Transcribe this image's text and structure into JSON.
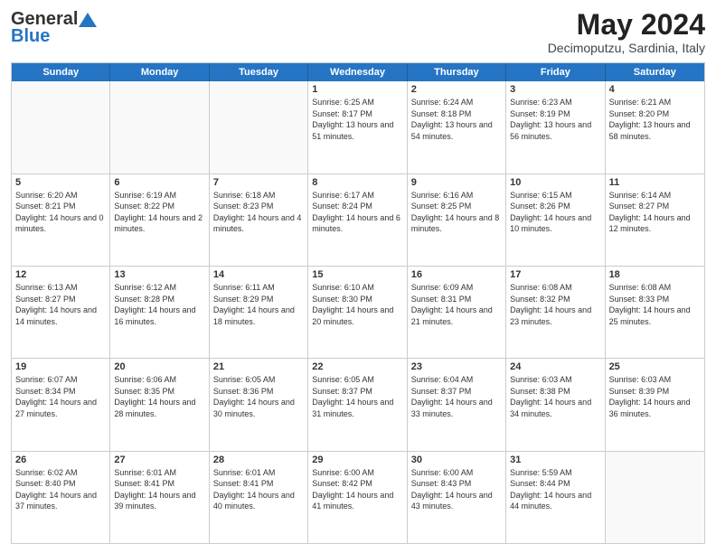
{
  "header": {
    "logo_general": "General",
    "logo_blue": "Blue",
    "month_title": "May 2024",
    "location": "Decimoputzu, Sardinia, Italy"
  },
  "calendar": {
    "days": [
      "Sunday",
      "Monday",
      "Tuesday",
      "Wednesday",
      "Thursday",
      "Friday",
      "Saturday"
    ],
    "rows": [
      [
        {
          "day": "",
          "empty": true
        },
        {
          "day": "",
          "empty": true
        },
        {
          "day": "",
          "empty": true
        },
        {
          "day": "1",
          "sunrise": "Sunrise: 6:25 AM",
          "sunset": "Sunset: 8:17 PM",
          "daylight": "Daylight: 13 hours and 51 minutes."
        },
        {
          "day": "2",
          "sunrise": "Sunrise: 6:24 AM",
          "sunset": "Sunset: 8:18 PM",
          "daylight": "Daylight: 13 hours and 54 minutes."
        },
        {
          "day": "3",
          "sunrise": "Sunrise: 6:23 AM",
          "sunset": "Sunset: 8:19 PM",
          "daylight": "Daylight: 13 hours and 56 minutes."
        },
        {
          "day": "4",
          "sunrise": "Sunrise: 6:21 AM",
          "sunset": "Sunset: 8:20 PM",
          "daylight": "Daylight: 13 hours and 58 minutes."
        }
      ],
      [
        {
          "day": "5",
          "sunrise": "Sunrise: 6:20 AM",
          "sunset": "Sunset: 8:21 PM",
          "daylight": "Daylight: 14 hours and 0 minutes."
        },
        {
          "day": "6",
          "sunrise": "Sunrise: 6:19 AM",
          "sunset": "Sunset: 8:22 PM",
          "daylight": "Daylight: 14 hours and 2 minutes."
        },
        {
          "day": "7",
          "sunrise": "Sunrise: 6:18 AM",
          "sunset": "Sunset: 8:23 PM",
          "daylight": "Daylight: 14 hours and 4 minutes."
        },
        {
          "day": "8",
          "sunrise": "Sunrise: 6:17 AM",
          "sunset": "Sunset: 8:24 PM",
          "daylight": "Daylight: 14 hours and 6 minutes."
        },
        {
          "day": "9",
          "sunrise": "Sunrise: 6:16 AM",
          "sunset": "Sunset: 8:25 PM",
          "daylight": "Daylight: 14 hours and 8 minutes."
        },
        {
          "day": "10",
          "sunrise": "Sunrise: 6:15 AM",
          "sunset": "Sunset: 8:26 PM",
          "daylight": "Daylight: 14 hours and 10 minutes."
        },
        {
          "day": "11",
          "sunrise": "Sunrise: 6:14 AM",
          "sunset": "Sunset: 8:27 PM",
          "daylight": "Daylight: 14 hours and 12 minutes."
        }
      ],
      [
        {
          "day": "12",
          "sunrise": "Sunrise: 6:13 AM",
          "sunset": "Sunset: 8:27 PM",
          "daylight": "Daylight: 14 hours and 14 minutes."
        },
        {
          "day": "13",
          "sunrise": "Sunrise: 6:12 AM",
          "sunset": "Sunset: 8:28 PM",
          "daylight": "Daylight: 14 hours and 16 minutes."
        },
        {
          "day": "14",
          "sunrise": "Sunrise: 6:11 AM",
          "sunset": "Sunset: 8:29 PM",
          "daylight": "Daylight: 14 hours and 18 minutes."
        },
        {
          "day": "15",
          "sunrise": "Sunrise: 6:10 AM",
          "sunset": "Sunset: 8:30 PM",
          "daylight": "Daylight: 14 hours and 20 minutes."
        },
        {
          "day": "16",
          "sunrise": "Sunrise: 6:09 AM",
          "sunset": "Sunset: 8:31 PM",
          "daylight": "Daylight: 14 hours and 21 minutes."
        },
        {
          "day": "17",
          "sunrise": "Sunrise: 6:08 AM",
          "sunset": "Sunset: 8:32 PM",
          "daylight": "Daylight: 14 hours and 23 minutes."
        },
        {
          "day": "18",
          "sunrise": "Sunrise: 6:08 AM",
          "sunset": "Sunset: 8:33 PM",
          "daylight": "Daylight: 14 hours and 25 minutes."
        }
      ],
      [
        {
          "day": "19",
          "sunrise": "Sunrise: 6:07 AM",
          "sunset": "Sunset: 8:34 PM",
          "daylight": "Daylight: 14 hours and 27 minutes."
        },
        {
          "day": "20",
          "sunrise": "Sunrise: 6:06 AM",
          "sunset": "Sunset: 8:35 PM",
          "daylight": "Daylight: 14 hours and 28 minutes."
        },
        {
          "day": "21",
          "sunrise": "Sunrise: 6:05 AM",
          "sunset": "Sunset: 8:36 PM",
          "daylight": "Daylight: 14 hours and 30 minutes."
        },
        {
          "day": "22",
          "sunrise": "Sunrise: 6:05 AM",
          "sunset": "Sunset: 8:37 PM",
          "daylight": "Daylight: 14 hours and 31 minutes."
        },
        {
          "day": "23",
          "sunrise": "Sunrise: 6:04 AM",
          "sunset": "Sunset: 8:37 PM",
          "daylight": "Daylight: 14 hours and 33 minutes."
        },
        {
          "day": "24",
          "sunrise": "Sunrise: 6:03 AM",
          "sunset": "Sunset: 8:38 PM",
          "daylight": "Daylight: 14 hours and 34 minutes."
        },
        {
          "day": "25",
          "sunrise": "Sunrise: 6:03 AM",
          "sunset": "Sunset: 8:39 PM",
          "daylight": "Daylight: 14 hours and 36 minutes."
        }
      ],
      [
        {
          "day": "26",
          "sunrise": "Sunrise: 6:02 AM",
          "sunset": "Sunset: 8:40 PM",
          "daylight": "Daylight: 14 hours and 37 minutes."
        },
        {
          "day": "27",
          "sunrise": "Sunrise: 6:01 AM",
          "sunset": "Sunset: 8:41 PM",
          "daylight": "Daylight: 14 hours and 39 minutes."
        },
        {
          "day": "28",
          "sunrise": "Sunrise: 6:01 AM",
          "sunset": "Sunset: 8:41 PM",
          "daylight": "Daylight: 14 hours and 40 minutes."
        },
        {
          "day": "29",
          "sunrise": "Sunrise: 6:00 AM",
          "sunset": "Sunset: 8:42 PM",
          "daylight": "Daylight: 14 hours and 41 minutes."
        },
        {
          "day": "30",
          "sunrise": "Sunrise: 6:00 AM",
          "sunset": "Sunset: 8:43 PM",
          "daylight": "Daylight: 14 hours and 43 minutes."
        },
        {
          "day": "31",
          "sunrise": "Sunrise: 5:59 AM",
          "sunset": "Sunset: 8:44 PM",
          "daylight": "Daylight: 14 hours and 44 minutes."
        },
        {
          "day": "",
          "empty": true
        }
      ]
    ]
  }
}
